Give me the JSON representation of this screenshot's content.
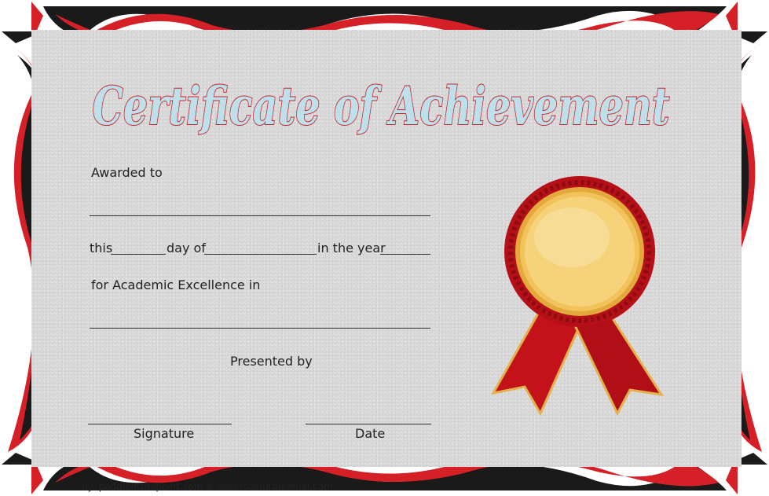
{
  "certificate": {
    "title": "Certificate of Achievement",
    "awarded_to_label": "Awarded to",
    "this_label": "this",
    "day_of_label": "day of",
    "in_the_year_label": "in the year",
    "academic_label": "for Academic Excellence  in",
    "presented_by_label": "Presented by",
    "signature_label": "Signature",
    "date_label": "Date",
    "credit": "by: paddleatthepoint.com & watercolourbiennial.com"
  },
  "colors": {
    "frame_red": "#d62027",
    "frame_black": "#1a1a1a",
    "paper": "#d9d9d9",
    "title_fill": "#bfe0ea",
    "title_outline": "#c0262e",
    "medal_gold": "#f2c35a",
    "ribbon_red": "#c4121b"
  },
  "icons": {
    "award": "award-ribbon-medal-icon"
  }
}
